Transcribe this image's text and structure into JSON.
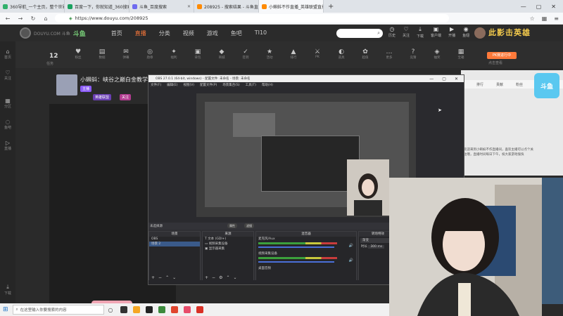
{
  "browser": {
    "tabs": [
      {
        "label": "360导航_一个主页，整个世界",
        "color": "#32b16c",
        "active": false
      },
      {
        "label": "百度一下，你就知道_360搜索",
        "color": "#19a15f",
        "active": false
      },
      {
        "label": "斗鱼_百度搜索",
        "color": "#6f6bf0",
        "active": false
      },
      {
        "label": "208925 - 搜索结果 - 斗鱼直播",
        "color": "#ff8a00",
        "active": false
      },
      {
        "label": "小蝌蚪不作直播_英雄联盟直播",
        "color": "#ff8a00",
        "active": true
      }
    ],
    "new_tab": "+",
    "url": "https://www.douyu.com/208925",
    "url_icon": "shield-icon"
  },
  "site": {
    "logo_text": "DOUYU.COM 斗鱼",
    "logo_badge": "斗鱼",
    "nav": [
      "首页",
      "直播",
      "分类",
      "视频",
      "游戏",
      "鱼吧",
      "TI10"
    ],
    "nav_active": 1,
    "header_icons": [
      "历史",
      "关注",
      "下载",
      "客户端",
      "开播",
      "鱼翅"
    ],
    "banner": "此影击英雄"
  },
  "rail": [
    "首页",
    "关注",
    "分区",
    "鱼吧",
    "直播",
    "下载"
  ],
  "gift_strip": {
    "count": "12",
    "count_sub": "任务",
    "gifts": [
      "粉丝",
      "数据",
      "弹幕",
      "勋章",
      "福利",
      "背包",
      "商城",
      "签到",
      "活动",
      "排行",
      "PK",
      "道具",
      "超值",
      "更多",
      "竞猜",
      "抽奖",
      "宝箱"
    ],
    "pk_button": "PK赛进行中",
    "pk_sub": "点击查看"
  },
  "streamer": {
    "title": "小蝌蚪：峡谷之巅白金教学",
    "tags": [
      "主播",
      "英雄联盟",
      "关注"
    ]
  },
  "right_panel": {
    "tabs": [
      "排行",
      "贡献",
      "粉丝"
    ],
    "text": "欢迎来到小蝌蚪不作直播间，喜欢主播可以点个关注哦，直播时间每日下午，祝大家游戏愉快",
    "badge": "斗鱼"
  },
  "obs": {
    "title": "OBS 27.0.1 (64-bit, windows) - 配置文件: 未命名 - 场景: 未命名",
    "menu": [
      "文件(F)",
      "编辑(E)",
      "视图(V)",
      "配置文件(P)",
      "场景集合(S)",
      "工具(T)",
      "帮助(H)"
    ],
    "no_source": "未选择源",
    "props_btn": "属性",
    "filter_btn": "滤镜",
    "scenes_title": "场景",
    "scenes": [
      "OBS",
      "场景 2"
    ],
    "sources_title": "来源",
    "sources": [
      "文本 (GDI+)",
      "视频采集设备",
      "显示器采集"
    ],
    "mixer_title": "混音器",
    "mixer": [
      {
        "name": "麦克风/Aux",
        "db": "0.0 dB"
      },
      {
        "name": "视频采集设备",
        "db": "0.0 dB"
      },
      {
        "name": "桌面音频",
        "db": "0.0 dB"
      }
    ],
    "transition_title": "转场特效",
    "transition": "渐变",
    "duration_label": "时长",
    "duration": "300 ms",
    "status": [
      "LIVE: 00:00:00",
      "REC: 00:00:00",
      "CPU: 0.4%"
    ]
  },
  "taskbar": {
    "search_placeholder": "在这里输入你要搜索的内容",
    "app_colors": [
      "#333333",
      "#f5a623",
      "#222222",
      "#3c8a3c",
      "#e0452e",
      "#e74c6a",
      "#d93025"
    ]
  },
  "colors": {
    "accent": "#ff7a3a",
    "header_bg": "#2b2b2b"
  }
}
